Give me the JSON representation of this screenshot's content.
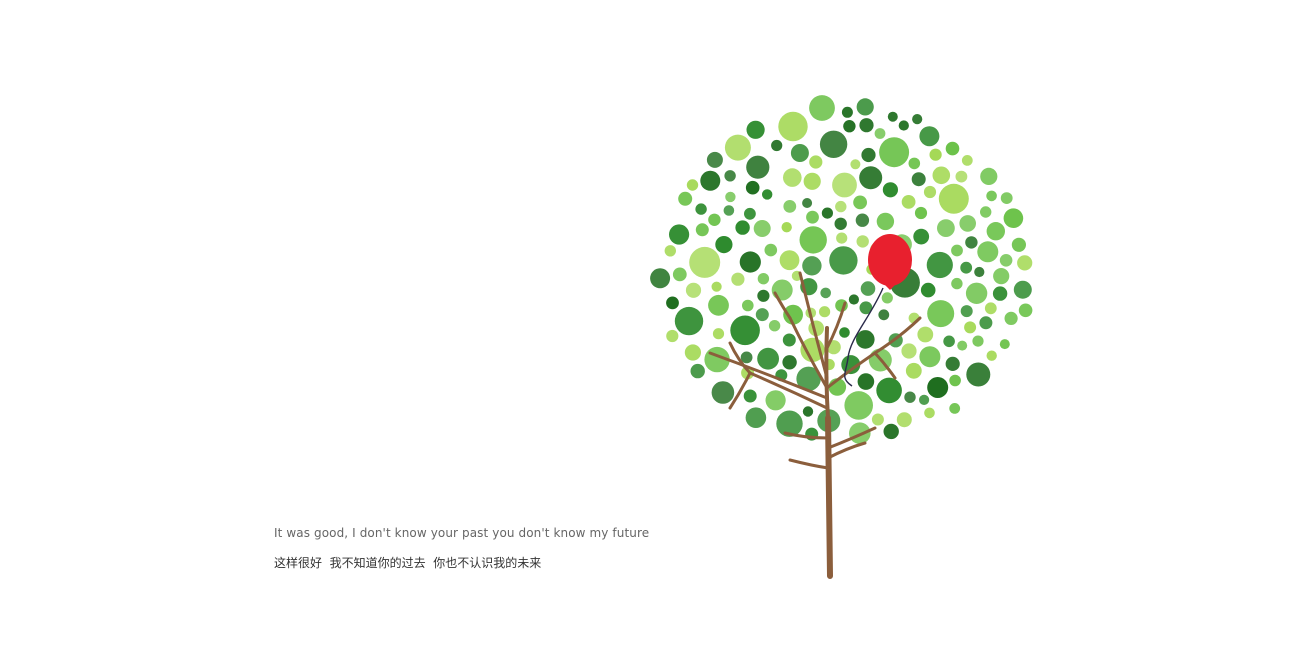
{
  "quote": {
    "english": "It was good, I don't know your past you don't know my future",
    "chinese": "这样很好  我不知道你的过去  你也不认识我的未来"
  },
  "illustration": {
    "name": "watercolor-tree-illustration",
    "palette": {
      "leaf_light": "#a5d957",
      "leaf_mid": "#6cc24a",
      "leaf_dark": "#2e8b2e",
      "leaf_deep": "#1f6e1f",
      "trunk": "#8b5e3c",
      "balloon": "#e8202e",
      "string": "#2a2a4a"
    }
  }
}
